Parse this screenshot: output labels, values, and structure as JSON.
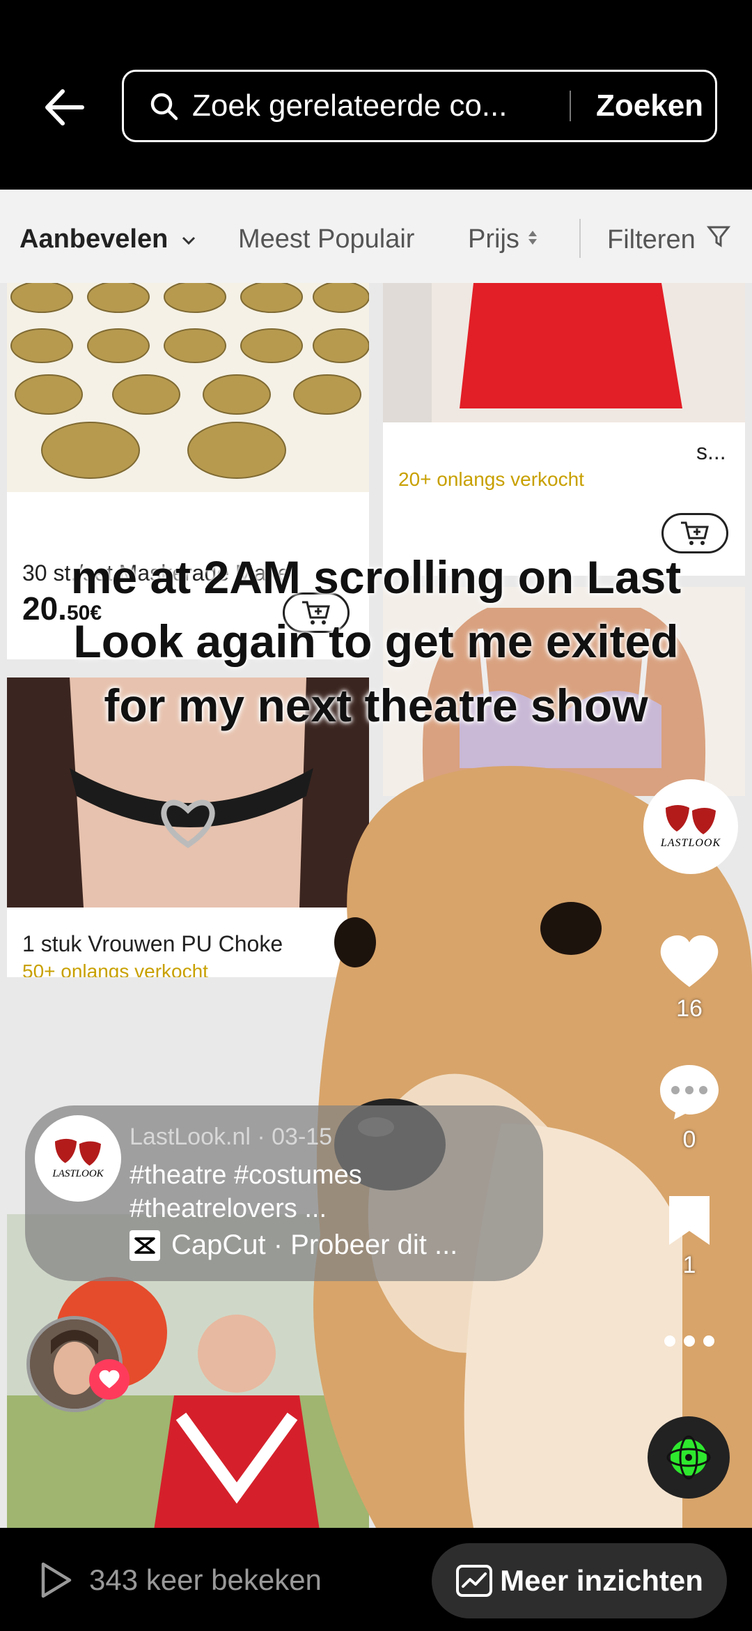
{
  "search": {
    "value": "Zoek gerelateerde co...",
    "submit_label": "Zoeken"
  },
  "shop": {
    "tabs": [
      {
        "label": "Aanbevelen",
        "active": true
      },
      {
        "label": "Meest Populair",
        "active": false
      },
      {
        "label": "Prijs",
        "active": false
      },
      {
        "label": "Filteren",
        "active": false
      }
    ],
    "products": [
      {
        "title": "30 st./set Maskerade Make-",
        "price_main": "20.",
        "price_small": "50€"
      },
      {
        "title": "1 stuk Vrouwen PU Choke",
        "sold": "50+ onlangs verkocht"
      },
      {
        "title": "s...",
        "sold": "20+ onlangs verkocht"
      }
    ]
  },
  "caption": "me at 2AM scrolling on Last Look again to get me exited for my next theatre show",
  "rail": {
    "likes": "16",
    "comments": "0",
    "saves": "1"
  },
  "post": {
    "author": "LastLook.nl",
    "date": "03-15",
    "tags_line1": "#theatre #costumes",
    "tags_line2": "#theatrelovers ...",
    "capcut_text": "CapCut · Probeer dit ..."
  },
  "logo_text": "LASTLOOK",
  "bottom": {
    "views": "343 keer bekeken",
    "insights_label": "Meer inzichten"
  },
  "colors": {
    "like_badge": "#ff3b5c",
    "sold_text": "#c8a000",
    "green_accent": "#2ee82e"
  }
}
